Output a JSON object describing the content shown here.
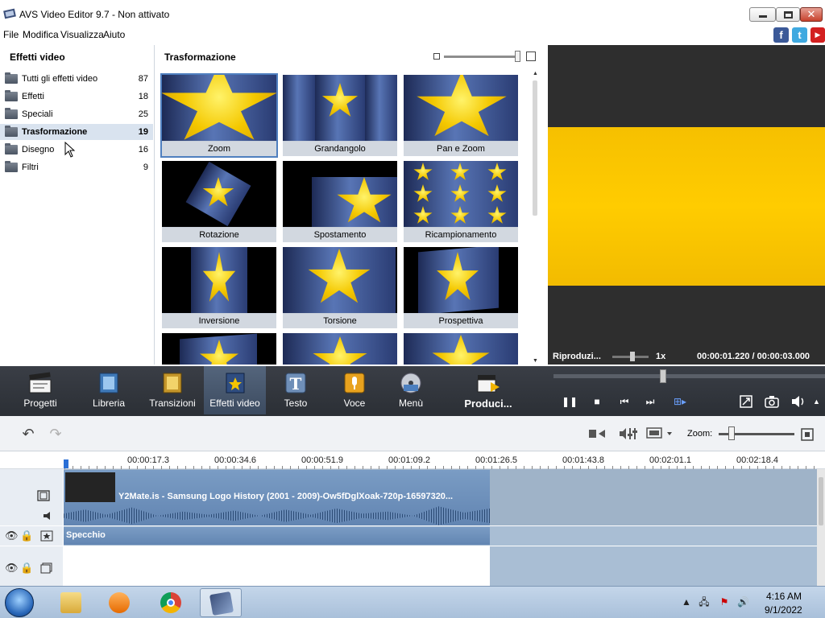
{
  "window": {
    "title": "AVS Video Editor 9.7 - Non attivato"
  },
  "menu": [
    "File",
    "Modifica",
    "Visualizza",
    "Aiuto"
  ],
  "social": {
    "facebook": "f",
    "twitter": "t",
    "youtube": "▶"
  },
  "left_panel": {
    "title": "Effetti video",
    "categories": [
      {
        "label": "Tutti gli effetti video",
        "count": "87"
      },
      {
        "label": "Effetti",
        "count": "18"
      },
      {
        "label": "Speciali",
        "count": "25"
      },
      {
        "label": "Trasformazione",
        "count": "19"
      },
      {
        "label": "Disegno",
        "count": "16"
      },
      {
        "label": "Filtri",
        "count": "9"
      }
    ],
    "selected": "Trasformazione"
  },
  "grid_panel": {
    "title": "Trasformazione",
    "effects": [
      "Zoom",
      "Grandangolo",
      "Pan e Zoom",
      "Rotazione",
      "Spostamento",
      "Ricampionamento",
      "Inversione",
      "Torsione",
      "Prospettiva"
    ],
    "selected": "Zoom"
  },
  "preview": {
    "mode_label": "Riproduzi...",
    "speed": "1x",
    "time": "00:00:01.220  /  00:00:03.000"
  },
  "toolbar": {
    "tools": [
      "Progetti",
      "Libreria",
      "Transizioni",
      "Effetti video",
      "Testo",
      "Voce",
      "Menù",
      "Produci..."
    ],
    "selected": "Effetti video",
    "playback": {
      "pause": "❚❚",
      "stop": "■",
      "prev": "⏮",
      "next": "⏭",
      "mark": "⊞▸"
    }
  },
  "timeline": {
    "zoom_label": "Zoom:",
    "ruler": [
      "00:00:17.3",
      "00:00:34.6",
      "00:00:51.9",
      "00:01:09.2",
      "00:01:26.5",
      "00:01:43.8",
      "00:02:01.1",
      "00:02:18.4"
    ],
    "video_clip_title": "Y2Mate.is - Samsung Logo History (2001 - 2009)-Ow5fDglXoak-720p-16597320...",
    "effect_clip_title": "Specchio"
  },
  "taskbar": {
    "time": "4:16 AM",
    "date": "9/1/2022"
  }
}
